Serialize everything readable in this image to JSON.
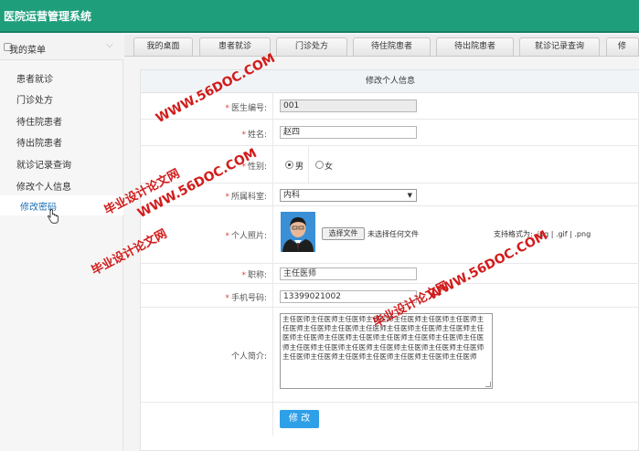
{
  "app": {
    "title": "医院运营管理系统"
  },
  "sidebar": {
    "header": "我的菜单",
    "items": [
      {
        "label": "患者就诊"
      },
      {
        "label": "门诊处方"
      },
      {
        "label": "待住院患者"
      },
      {
        "label": "待出院患者"
      },
      {
        "label": "就诊记录查询"
      },
      {
        "label": "修改个人信息"
      },
      {
        "label": "修改密码",
        "active": true
      }
    ]
  },
  "tabs": [
    {
      "label": "我的桌面"
    },
    {
      "label": "患者就诊"
    },
    {
      "label": "门诊处方"
    },
    {
      "label": "待住院患者"
    },
    {
      "label": "待出院患者"
    },
    {
      "label": "就诊记录查询"
    },
    {
      "label": "修"
    }
  ],
  "form": {
    "title": "修改个人信息",
    "doctor_id": {
      "label": "医生编号:",
      "value": "001"
    },
    "name": {
      "label": "姓名:",
      "value": "赵四"
    },
    "gender": {
      "label": "性别:",
      "options": [
        "男",
        "女"
      ],
      "selected": "男"
    },
    "department": {
      "label": "所属科室:",
      "value": "内科"
    },
    "photo": {
      "label": "个人照片:",
      "button": "选择文件",
      "no_file": "未选择任何文件",
      "hint": "支持格式为: .jpg | .gif | .png"
    },
    "title_field": {
      "label": "职称:",
      "value": "主任医师"
    },
    "phone": {
      "label": "手机号码:",
      "value": "13399021002"
    },
    "bio": {
      "label": "个人简介:",
      "value": "主任医师主任医师主任医师主任医师主任医师主任医师主任医师主任医师主任医师主任医师主任医师主任医师主任医师主任医师主任医师主任医师主任医师主任医师主任医师主任医师主任医师主任医师主任医师主任医师主任医师主任医师主任医师主任医师主任医师主任医师主任医师主任医师主任医师主任医师主任医师主任医师"
    },
    "submit": "修 改"
  },
  "watermarks": {
    "a": "WWW.56DOC.COM",
    "b": "毕业设计论文网",
    "c": "WWW.56DOC.COM",
    "d": "毕业设计论文网",
    "e": "WWW.56DOC.COM",
    "f": "毕业设计论文网"
  },
  "colors": {
    "header": "#1f9e7c",
    "button": "#2ea0e8",
    "watermark": "#d21b1b",
    "required": "#e04040"
  },
  "icons": {
    "menu": "menu-icon",
    "chevron": "chevron-down-icon",
    "cursor": "hand-cursor-icon"
  }
}
